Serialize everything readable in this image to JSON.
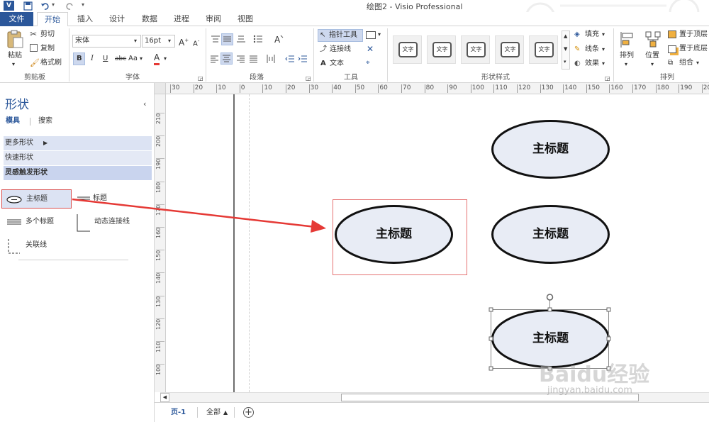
{
  "window": {
    "title": "绘图2 - Visio Professional"
  },
  "tabs": {
    "file": "文件",
    "items": [
      "开始",
      "插入",
      "设计",
      "数据",
      "进程",
      "审阅",
      "视图"
    ]
  },
  "ribbon": {
    "clipboard": {
      "paste": "粘贴",
      "cut": "剪切",
      "copy": "复制",
      "format_painter": "格式刷",
      "label": "剪贴板"
    },
    "font": {
      "name": "宋体",
      "size": "16pt",
      "case": "Aa",
      "label": "字体",
      "bold": "B",
      "italic": "I",
      "underline": "U",
      "strike": "abc",
      "color": "A"
    },
    "paragraph": {
      "label": "段落"
    },
    "tools": {
      "pointer": "指针工具",
      "connector": "连接线",
      "text": "文本",
      "label": "工具"
    },
    "shape_styles": {
      "swatch_text": "文字",
      "fill": "填充",
      "line": "线条",
      "effects": "效果",
      "label": "形状样式"
    },
    "arrange": {
      "align": "排列",
      "position": "位置",
      "bring_front": "置于顶层",
      "send_back": "置于底层",
      "group": "组合",
      "label": "排列"
    }
  },
  "shapes_panel": {
    "title": "形状",
    "tab_stencils": "模具",
    "tab_search": "搜索",
    "more_shapes": "更多形状",
    "quick_shapes": "快速形状",
    "stencil_name": "灵感触发形状",
    "items": [
      "主标题",
      "标题",
      "多个标题",
      "动态连接线",
      "关联线"
    ]
  },
  "rulers": {
    "h_ticks": [
      "30",
      "20",
      "10",
      "0",
      "10",
      "20",
      "30",
      "40",
      "50",
      "60",
      "70",
      "80",
      "90",
      "100",
      "110",
      "120",
      "130",
      "140",
      "150",
      "160",
      "170",
      "180",
      "190",
      "200"
    ],
    "v_ticks": [
      "210",
      "200",
      "190",
      "180",
      "170",
      "160",
      "150",
      "140",
      "130",
      "120",
      "110",
      "100"
    ]
  },
  "canvas": {
    "shape_text": "主标题"
  },
  "pages": {
    "page1": "页-1",
    "all": "全部"
  },
  "watermark": {
    "brand": "Baidu经验",
    "url": "jingyan.baidu.com"
  },
  "colors": {
    "accent": "#2b579a",
    "ellipse_fill": "#e8ecf5",
    "highlight": "#dce3f3",
    "annotation": "#e53935"
  }
}
